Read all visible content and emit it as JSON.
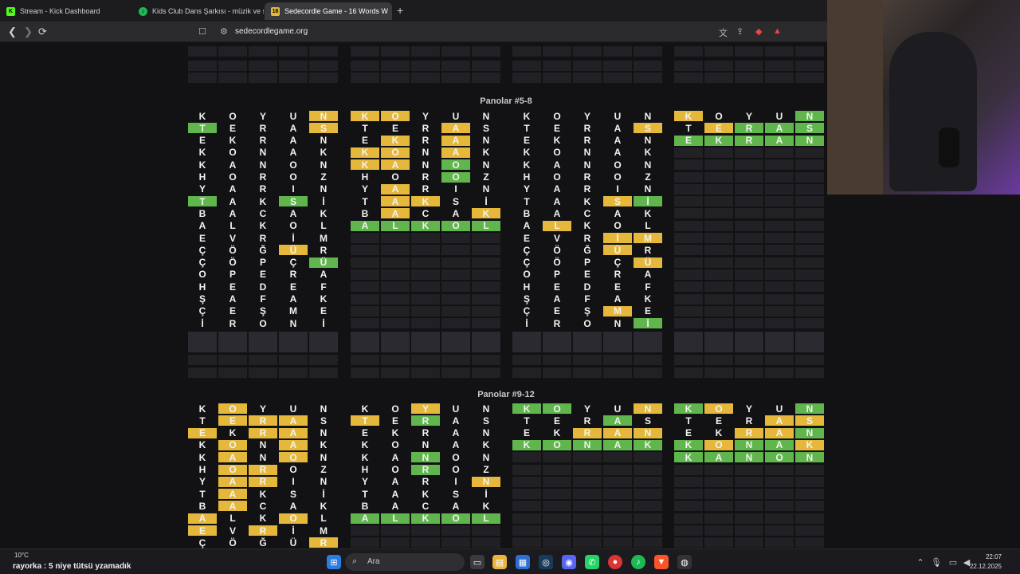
{
  "tabs": [
    {
      "title": "Stream - Kick Dashboard",
      "icon": "K",
      "color": "#53fc18"
    },
    {
      "title": "Kids Club Dans Şarkısı - müzik ve şarkı",
      "icon": "♪",
      "color": "#1db954"
    },
    {
      "title": "Sedecordle Game - 16 Words W",
      "icon": "16",
      "color": "#e5b83b"
    }
  ],
  "address": "sedecordlegame.org",
  "panels": {
    "title_5_8": "Panolar #5-8",
    "title_9_12": "Panolar #9-12"
  },
  "guesses": [
    "KOYUN",
    "TERAS",
    "EKRAN",
    "KONAK",
    "KANON",
    "HOROZ",
    "YARIN",
    "TAKSİ",
    "BACAK",
    "ALKOL",
    "EVRİM",
    "ÇÖĞÜR",
    "ÇÖPÇÜ",
    "OPERA",
    "HEDEF",
    "ŞAFAK",
    "ÇEŞME",
    "İRONİ"
  ],
  "boards_5_8": [
    [
      "....y",
      "g...y",
      ".....",
      ".....",
      ".....",
      ".....",
      ".....",
      "g..g.",
      ".....",
      ".....",
      ".....",
      "...y.",
      "....g",
      ".....",
      ".....",
      ".....",
      ".....",
      "....."
    ],
    [
      "yy...",
      "...y.",
      ".y.y.",
      "yy.y.",
      "yy.g.",
      "...g.",
      ".y...",
      ".yy..",
      ".y..y",
      "ggggg"
    ],
    [
      ".....",
      "....y",
      ".....",
      ".....",
      ".....",
      ".....",
      ".....",
      "...yg",
      ".....",
      ".y...",
      "...yy",
      "...y.",
      "....y",
      ".....",
      ".....",
      ".....",
      "...y.",
      "....g"
    ],
    [
      "y...g",
      ".yggg",
      "ggggg"
    ]
  ],
  "boards_9_12": [
    [
      ".y...",
      ".yyy.",
      "y.yy.",
      ".y.y.",
      ".y.y.",
      ".yy..",
      ".yy..",
      ".y...",
      ".y...",
      "y..y.",
      "y.y..",
      "....y"
    ],
    [
      "..y..",
      "y.g..",
      ".....",
      ".....",
      "..g..",
      "..g..",
      "....y",
      ".....",
      ".....",
      "ggggg"
    ],
    [
      "gg..y",
      "...g.",
      "..yyy",
      "ggggg"
    ],
    [
      "gy..g",
      "...yy",
      "..yyg",
      "gyggy",
      "ggggg"
    ]
  ],
  "taskbar": {
    "search_placeholder": "Ara",
    "weather": "10°C",
    "ticker": "rayorka : 5 niye tütsü yzamadık",
    "time": "22:07",
    "date": "22.12.2025"
  }
}
